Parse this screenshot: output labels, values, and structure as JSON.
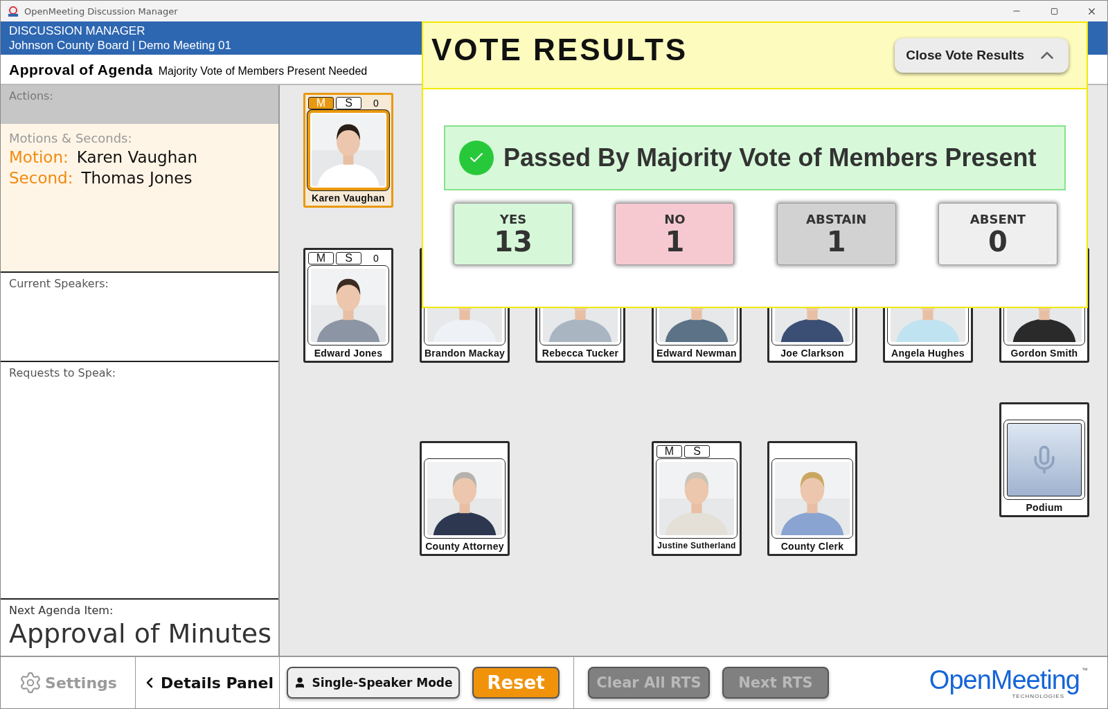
{
  "window": {
    "title": "OpenMeeting Discussion Manager"
  },
  "header": {
    "app": "DISCUSSION MANAGER",
    "meeting": "Johnson County Board | Demo Meeting 01"
  },
  "agenda": {
    "title": "Approval of Agenda",
    "requirement": "Majority Vote of Members Present Needed"
  },
  "sidebar": {
    "actions_label": "Actions:",
    "motions": {
      "label": "Motions & Seconds:",
      "entries": [
        {
          "role": "Motion:",
          "name": "Karen Vaughan"
        },
        {
          "role": "Second:",
          "name": "Thomas Jones"
        }
      ]
    },
    "current_speakers_label": "Current Speakers:",
    "requests_label": "Requests to Speak:",
    "next_item": {
      "label": "Next Agenda Item:",
      "title": "Approval of Minutes"
    }
  },
  "seats": [
    {
      "name": "Karen Vaughan",
      "kind": "member",
      "selected": true,
      "buttons": [
        {
          "label": "M",
          "selected": true
        },
        {
          "label": "S",
          "selected": false
        }
      ],
      "count": "0"
    },
    {
      "name": "Edward Jones",
      "kind": "member",
      "selected": false,
      "buttons": [
        {
          "label": "M",
          "selected": false
        },
        {
          "label": "S",
          "selected": false
        }
      ],
      "count": "0"
    },
    {
      "name": "Brandon Mackay",
      "kind": "member",
      "selected": false
    },
    {
      "name": "Rebecca Tucker",
      "kind": "member",
      "selected": false
    },
    {
      "name": "Edward Newman",
      "kind": "member",
      "selected": false
    },
    {
      "name": "Joe Clarkson",
      "kind": "member",
      "selected": false
    },
    {
      "name": "Angela Hughes",
      "kind": "member",
      "selected": false
    },
    {
      "name": "Gordon Smith",
      "kind": "member",
      "selected": false
    },
    {
      "name": "County Attorney",
      "kind": "member",
      "selected": false
    },
    {
      "name": "Justine Sutherland",
      "kind": "member",
      "selected": false,
      "buttons": [
        {
          "label": "M",
          "selected": false
        },
        {
          "label": "S",
          "selected": false
        }
      ]
    },
    {
      "name": "County Clerk",
      "kind": "member",
      "selected": false
    },
    {
      "name": "Podium",
      "kind": "podium",
      "selected": false
    }
  ],
  "vote_results": {
    "title": "VOTE RESULTS",
    "close_button": "Close Vote Results",
    "outcome": "Passed By Majority Vote of Members Present",
    "counts": [
      {
        "kind": "yes",
        "label": "YES",
        "value": "13"
      },
      {
        "kind": "no",
        "label": "NO",
        "value": "1"
      },
      {
        "kind": "abstain",
        "label": "ABSTAIN",
        "value": "1"
      },
      {
        "kind": "absent",
        "label": "ABSENT",
        "value": "0"
      }
    ]
  },
  "bottom_bar": {
    "settings": {
      "label": "Settings",
      "disabled": true
    },
    "details_panel": "Details Panel",
    "single_speaker": "Single-Speaker Mode",
    "reset": "Reset",
    "clear_rts": {
      "label": "Clear All RTS",
      "disabled": true
    },
    "next_rts": {
      "label": "Next RTS",
      "disabled": true
    }
  },
  "logo": {
    "name": "OpenMeeting",
    "mark": "™",
    "tagline": "TECHNOLOGIES"
  }
}
